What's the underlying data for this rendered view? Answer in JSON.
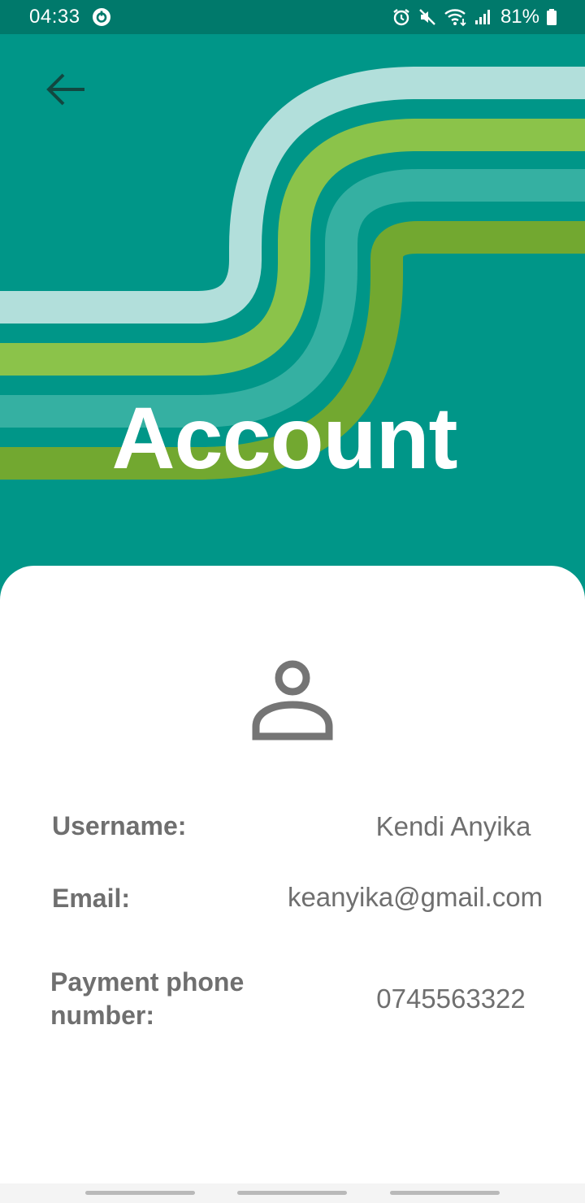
{
  "status_bar": {
    "time": "04:33",
    "left_icon": "data-saver-icon",
    "right_icons": [
      "alarm-icon",
      "mute-icon",
      "wifi-icon",
      "cell-signal-icon"
    ],
    "battery_percent": "81%"
  },
  "header": {
    "back_icon": "arrow-back-icon",
    "title": "Account",
    "colors": {
      "background": "#009688",
      "status_bar": "#00796b",
      "stripe_light_teal": "#b2dfdb",
      "stripe_light_green": "#8bc34a",
      "stripe_teal": "#35b0a2",
      "stripe_dark_green": "#72a830"
    }
  },
  "account": {
    "avatar_icon": "person-icon",
    "rows": [
      {
        "label": "Username:",
        "value": "Kendi Anyika"
      },
      {
        "label": "Email:",
        "value": "keanyika@gmail.com"
      },
      {
        "label": "Payment phone number:",
        "value": "0745563322"
      }
    ]
  }
}
